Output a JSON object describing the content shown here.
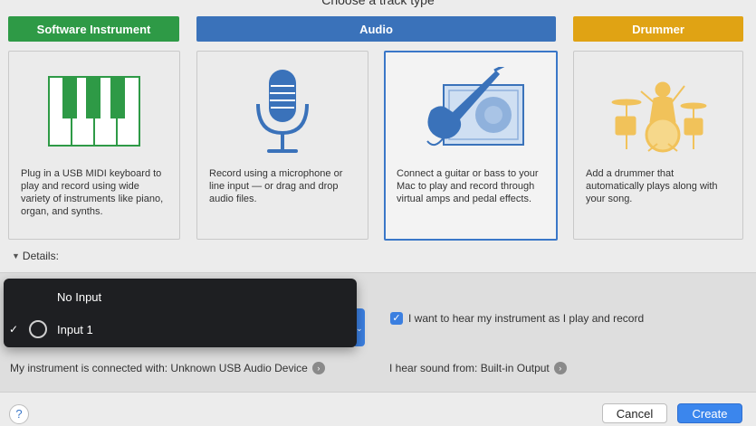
{
  "header": {
    "title": "Choose a track type"
  },
  "categories": [
    {
      "label": "Software Instrument",
      "color": "#2e9a46"
    },
    {
      "label": "Audio",
      "color": "#3a72ba"
    },
    {
      "label": "Drummer",
      "color": "#e0a314"
    }
  ],
  "cards": [
    {
      "desc": "Plug in a USB MIDI keyboard to play and record using wide variety of instruments like piano, organ, and synths.",
      "icon": "piano-keys-icon"
    },
    {
      "desc": "Record using a microphone or line input — or drag and drop audio files.",
      "icon": "microphone-icon"
    },
    {
      "desc": "Connect a guitar or bass to your Mac to play and record through virtual amps and pedal effects.",
      "icon": "guitar-amp-icon"
    },
    {
      "desc": "Add a drummer that automatically plays along with your song.",
      "icon": "drummer-icon"
    }
  ],
  "details_label": "Details:",
  "input_menu": {
    "items": [
      {
        "label": "No Input",
        "checked": false
      },
      {
        "label": "Input 1",
        "checked": true
      }
    ]
  },
  "monitor_checkbox": {
    "label": "I want to hear my instrument as I play and record",
    "checked": true
  },
  "instrument_connection": "My instrument is connected with: Unknown USB Audio Device",
  "sound_output": "I hear sound from: Built-in Output",
  "buttons": {
    "help": "?",
    "cancel": "Cancel",
    "create": "Create"
  },
  "colors": {
    "accent": "#3a77c8",
    "menu_bg": "#1e1f22"
  }
}
